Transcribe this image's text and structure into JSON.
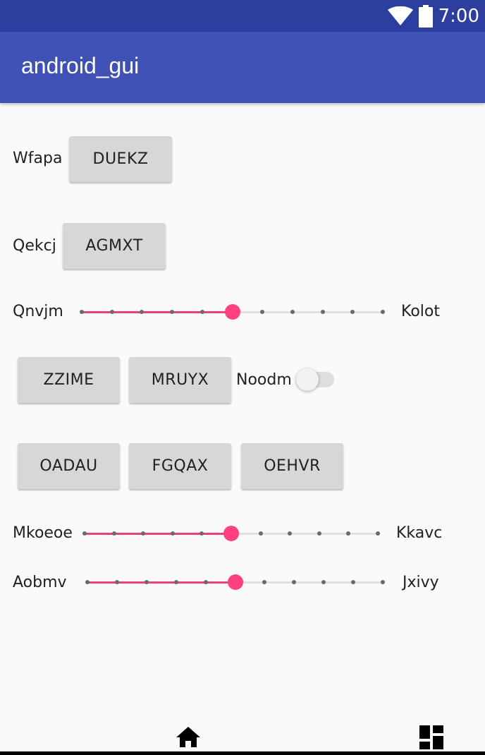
{
  "status_bar": {
    "time": "7:00",
    "icons": [
      "wifi-icon",
      "battery-icon"
    ]
  },
  "app_bar": {
    "title": "android_gui"
  },
  "row1": {
    "label": "Wfapa",
    "button": "DUEKZ"
  },
  "row2": {
    "label": "Qekcj",
    "button": "AGMXT"
  },
  "slider1": {
    "left_label": "Qnvjm",
    "right_label": "Kolot",
    "value_fraction": 0.5
  },
  "row4": {
    "button1": "ZZIME",
    "button2": "MRUYX",
    "switch_label": "Noodm",
    "switch_on": false
  },
  "row5": {
    "button1": "OADAU",
    "button2": "FGQAX",
    "button3": "OEHVR"
  },
  "slider2": {
    "left_label": "Mkoeoe",
    "right_label": "Kkavc",
    "value_fraction": 0.5
  },
  "slider3": {
    "left_label": "Aobmv",
    "right_label": "Jxivy",
    "value_fraction": 0.5
  },
  "nav_bar": {
    "icons": [
      "home-icon",
      "dashboard-icon"
    ]
  },
  "colors": {
    "status_bar": "#2c3e9e",
    "app_bar": "#3f51b5",
    "accent": "#ff4081",
    "button": "#d6d7d7"
  }
}
